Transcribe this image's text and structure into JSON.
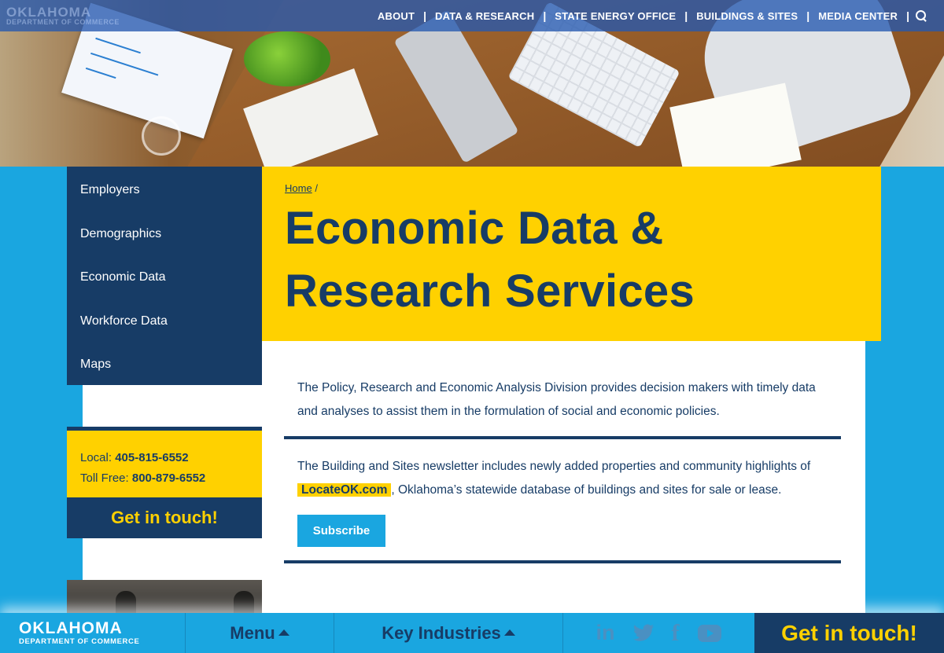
{
  "brand": {
    "name": "OKLAHOMA",
    "tagline": "DEPARTMENT OF COMMERCE"
  },
  "topnav": {
    "items": [
      {
        "label": "ABOUT"
      },
      {
        "label": "DATA & RESEARCH"
      },
      {
        "label": "STATE ENERGY OFFICE"
      },
      {
        "label": "BUILDINGS & SITES"
      },
      {
        "label": "MEDIA CENTER"
      }
    ],
    "separator": "|",
    "search_icon": "search-icon"
  },
  "sidebar": {
    "items": [
      {
        "label": "Employers"
      },
      {
        "label": "Demographics"
      },
      {
        "label": "Economic Data"
      },
      {
        "label": "Workforce Data"
      },
      {
        "label": "Maps"
      }
    ],
    "contact": {
      "local_label": "Local:",
      "local_phone": "405-815-6552",
      "tollfree_label": "Toll Free:",
      "tollfree_phone": "800-879-6552",
      "cta": "Get in touch!"
    }
  },
  "main": {
    "breadcrumb": {
      "home": "Home",
      "separator": "/"
    },
    "title_line1": "Economic Data &",
    "title_line2": "Research Services",
    "paragraph1": "The Policy, Research and Economic Analysis Division provides decision makers with timely data and analyses to assist them in the formulation of social and economic policies.",
    "paragraph2_before": "The Building and Sites newsletter includes newly added properties and community highlights of",
    "paragraph2_link": "LocateOK.com",
    "paragraph2_after": ", Oklahoma’s statewide database of buildings and sites for sale or lease.",
    "subscribe_label": "Subscribe"
  },
  "bottombar": {
    "menu_label": "Menu",
    "industries_label": "Key Industries",
    "social": {
      "linkedin": "in",
      "facebook": "f"
    },
    "cta": "Get in touch!"
  },
  "colors": {
    "navy": "#173c66",
    "yellow": "#ffd100",
    "sky": "#1aa6e0"
  }
}
